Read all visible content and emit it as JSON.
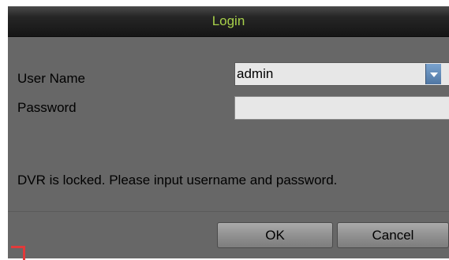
{
  "dialog": {
    "title": "Login",
    "username_label": "User Name",
    "username_value": "admin",
    "password_label": "Password",
    "password_value": "",
    "message": "DVR is locked. Please input username and password.",
    "ok_label": "OK",
    "cancel_label": "Cancel"
  },
  "icons": {
    "dropdown": "chevron-down-icon",
    "corner": "corner-mark-icon"
  },
  "colors": {
    "title_text": "#a7d04a",
    "dialog_background": "#676767",
    "dropdown_accent": "#4f76a3",
    "corner_mark": "#e23a3a"
  }
}
